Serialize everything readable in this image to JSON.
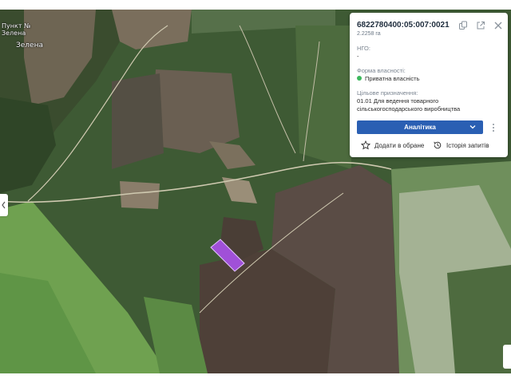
{
  "map": {
    "places": [
      {
        "name": "Пункт №",
        "sub": "Зелена"
      },
      {
        "name": "Зелена"
      }
    ],
    "parcel_color": "#a050d8"
  },
  "card": {
    "cadastral_number": "6822780400:05:007:0021",
    "area": "2.2258 га",
    "ngo_label": "НГО:",
    "ngo_value": "-",
    "ownership_label": "Форма власності:",
    "ownership_value": "Приватна власність",
    "ownership_color": "#3cb85c",
    "purpose_label": "Цільове призначення:",
    "purpose_value_line1": "01.01 Для ведення товарного",
    "purpose_value_line2": "сільськогосподарського виробництва",
    "analytics_label": "Аналітика",
    "favorite_label": "Додати в обране",
    "history_label": "Історія запитів",
    "accent_color": "#2a5fb3",
    "icons": [
      "copy-icon",
      "open-external-icon",
      "close-icon",
      "chevron-down-icon",
      "more-vertical-icon",
      "star-icon",
      "history-icon"
    ]
  }
}
